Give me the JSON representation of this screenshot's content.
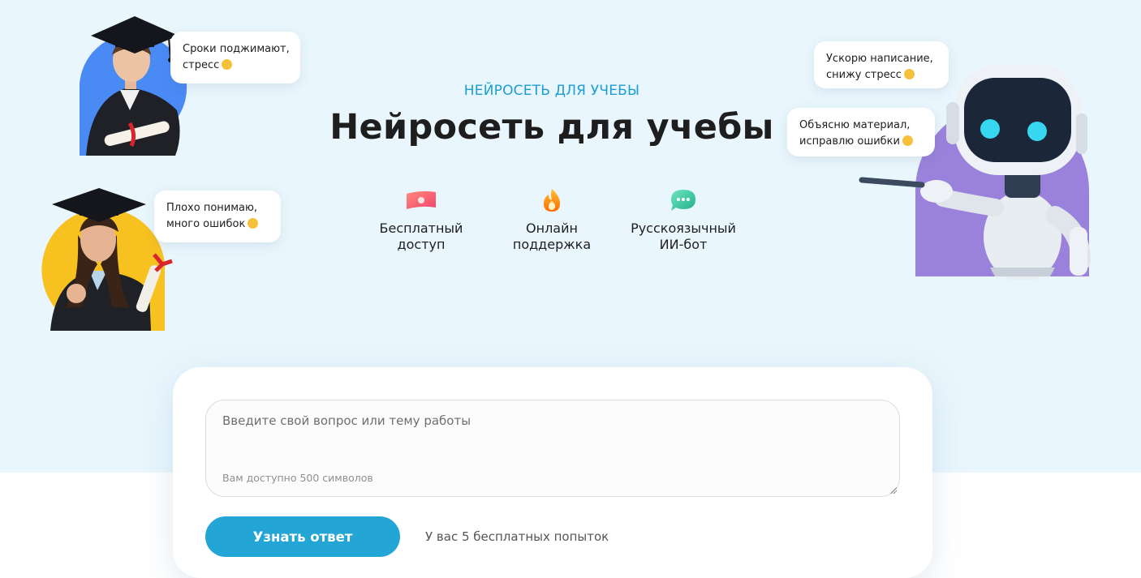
{
  "hero": {
    "subtitle": "НЕЙРОСЕТЬ ДЛЯ УЧЕБЫ",
    "title": "Нейросеть для учебы"
  },
  "features": [
    {
      "icon": "money-icon",
      "line1": "Бесплатный",
      "line2": "доступ"
    },
    {
      "icon": "flame-icon",
      "line1": "Онлайн",
      "line2": "поддержка"
    },
    {
      "icon": "chat-icon",
      "line1": "Русскоязычный",
      "line2": "ИИ-бот"
    }
  ],
  "bubbles": {
    "student1": {
      "line1": "Сроки поджимают,",
      "line2": "стресс"
    },
    "student2": {
      "line1": "Плохо понимаю,",
      "line2": "много ошибок"
    },
    "robot1": {
      "line1": "Ускорю написание,",
      "line2": "снижу стресс"
    },
    "robot2": {
      "line1": "Объясню материал,",
      "line2": "исправлю ошибки"
    }
  },
  "form": {
    "placeholder": "Введите свой вопрос или тему работы",
    "char_hint": "Вам доступно 500 символов",
    "submit_label": "Узнать ответ",
    "attempts_text": "У вас 5 бесплатных попыток"
  },
  "colors": {
    "hero_bg": "#eaf6fd",
    "accent": "#23a6d5",
    "subtitle": "#1a9fd0",
    "student1_circle": "#4a8af5",
    "student2_circle": "#f7c21f",
    "robot_blob": "#9a82dc"
  }
}
